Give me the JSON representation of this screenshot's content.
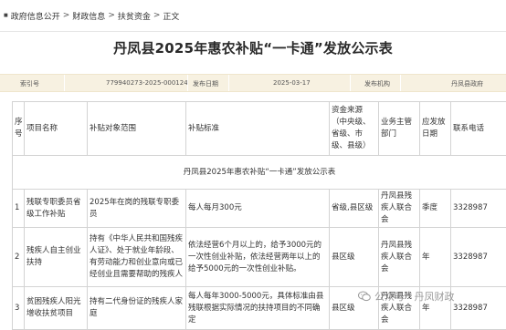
{
  "breadcrumb": {
    "items": [
      "政府信息公开",
      "财政信息",
      "扶贫资金",
      "正文"
    ],
    "separator": ">"
  },
  "page_title": "丹凤县2025年惠农补贴“一卡通”发放公示表",
  "meta": {
    "index_label": "索引号",
    "index_value": "779940273-2025-000124",
    "date_label": "发布日期",
    "date_value": "2025-03-17",
    "org_label": "发布机构",
    "org_value": "丹凤县政府"
  },
  "table": {
    "caption": "丹凤县2025年惠农补贴“一卡通”发放公示表",
    "headers": [
      "序号",
      "项目名称",
      "补贴对象范围",
      "补贴标准",
      "资金来源（中央级、省级、市级、县级）",
      "业务主管部门",
      "应发放日期",
      "联系电话"
    ],
    "rows": [
      {
        "no": "1",
        "name": "残联专职委员省级工作补贴",
        "scope": "2025年在岗的残联专职委员",
        "standard": "每人每月300元",
        "source": "省级,县区级",
        "dept": "丹凤县残疾人联合会",
        "period": "季度",
        "phone": "3328987"
      },
      {
        "no": "2",
        "name": "残疾人自主创业扶持",
        "scope": "持有《中华人民共和国残疾人证》、处于就业年龄段、有劳动能力和创业意向或已经创业且需要帮助的残疾人",
        "standard": "依法经营6个月以上的，给予3000元的一次性创业补贴，依法经营两年以上的给予5000元的一次性创业补贴。",
        "source": "县区级",
        "dept": "丹凤县残疾人联合会",
        "period": "年",
        "phone": "3328987"
      },
      {
        "no": "3",
        "name": "贫困残疾人阳光增收扶贫项目",
        "scope": "持有二代身份证的残疾人家庭",
        "standard": "每人每年3000-5000元，具体标准由县残联根据实际情况的扶持项目的不同确定",
        "source": "县区级",
        "dept": "丹凤县残疾人联合会",
        "period": "年",
        "phone": "3328987"
      }
    ]
  },
  "watermark": {
    "text": "公众号 · 丹凤财政",
    "icon": "wechat-icon"
  }
}
